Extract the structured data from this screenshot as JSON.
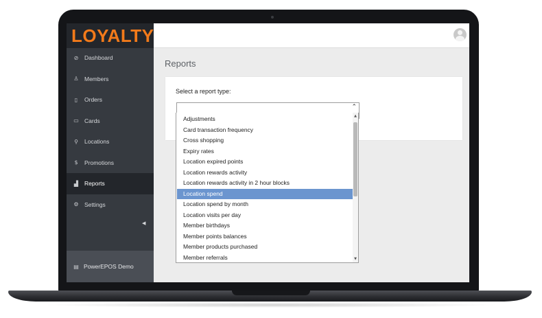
{
  "app": {
    "logo_text": "LOYALTY",
    "colors": {
      "brand_orange": "#f27a1a",
      "sidebar_bg": "#363a40",
      "sidebar_active_bg": "#23262b",
      "selection_blue": "#6b95cf"
    }
  },
  "sidebar": {
    "items": [
      {
        "label": "Dashboard",
        "icon": "dashboard-icon"
      },
      {
        "label": "Members",
        "icon": "user-icon"
      },
      {
        "label": "Orders",
        "icon": "book-icon"
      },
      {
        "label": "Cards",
        "icon": "card-icon"
      },
      {
        "label": "Locations",
        "icon": "map-pin-icon"
      },
      {
        "label": "Promotions",
        "icon": "dollar-icon"
      },
      {
        "label": "Reports",
        "icon": "bar-chart-icon",
        "active": true
      },
      {
        "label": "Settings",
        "icon": "gear-icon"
      }
    ],
    "footer_label": "PowerEPOS Demo"
  },
  "main": {
    "page_title": "Reports",
    "select_label": "Select a report type:",
    "report_options": [
      "Adjustments",
      "Card transaction frequency",
      "Cross shopping",
      "Expiry rates",
      "Location expired points",
      "Location rewards activity",
      "Location rewards activity in 2 hour blocks",
      "Location spend",
      "Location spend by month",
      "Location visits per day",
      "Member birthdays",
      "Member points balances",
      "Member products purchased",
      "Member referrals"
    ],
    "selected_option": "Location spend"
  }
}
